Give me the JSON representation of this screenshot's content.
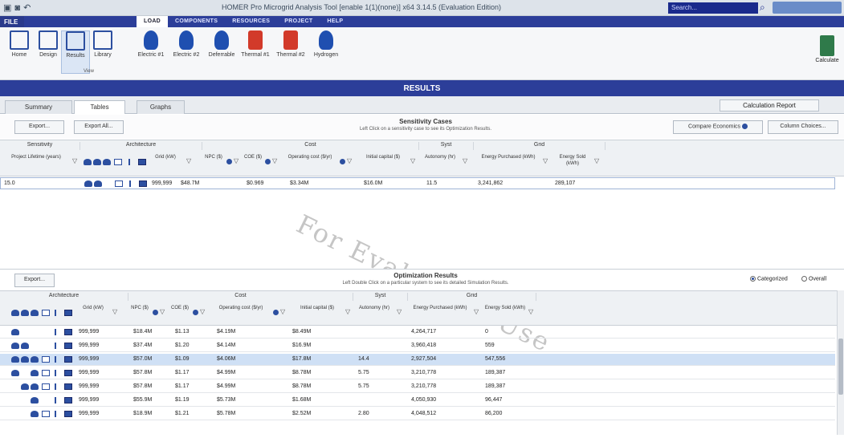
{
  "titlebar": {
    "title": "HOMER Pro Microgrid Analysis Tool [enable 1(1)(none)]  x64 3.14.5 (Evaluation Edition)",
    "search_placeholder": "Search..."
  },
  "menu": {
    "file": "FILE",
    "tabs": [
      "LOAD",
      "COMPONENTS",
      "RESOURCES",
      "PROJECT",
      "HELP"
    ],
    "active_tab": "LOAD"
  },
  "ribbon": {
    "buttons": [
      "Home",
      "Design",
      "Results",
      "Library",
      "Electric #1",
      "Electric #2",
      "Deferrable",
      "Thermal #1",
      "Thermal #2",
      "Hydrogen"
    ],
    "view_label": "View",
    "calculate": "Calculate"
  },
  "banner": "RESULTS",
  "view_tabs": {
    "tabs": [
      "Summary",
      "Tables",
      "Graphs"
    ],
    "active": "Tables",
    "calc_report": "Calculation Report"
  },
  "sensitivity": {
    "export": "Export...",
    "export_all": "Export All...",
    "title": "Sensitivity Cases",
    "subtitle": "Left Click on a sensitivity case to see its Optimization Results.",
    "compare_economics": "Compare Economics",
    "column_choices": "Column Choices...",
    "groups": [
      "Sensitivity",
      "Architecture",
      "Cost",
      "Syst",
      "Grid"
    ],
    "columns": [
      "Project Lifetime (years)",
      "Grid (kW)",
      "NPC ($)",
      "COE ($)",
      "Operating cost ($/yr)",
      "Initial capital ($)",
      "Autonomy (hr)",
      "Energy Purchased (kWh)",
      "Energy Sold (kWh)"
    ],
    "rows": [
      {
        "lifetime": "15.0",
        "grid": "999,999",
        "npc": "$48.7M",
        "coe": "$0.969",
        "opcost": "$3.34M",
        "capital": "$16.0M",
        "autonomy": "11.5",
        "purchased": "3,241,862",
        "sold": "289,107"
      }
    ]
  },
  "optimization": {
    "export": "Export...",
    "title": "Optimization Results",
    "subtitle": "Left Double Click on a particular system to see its detailed Simulation Results.",
    "categorized": "Categorized",
    "overall": "Overall",
    "groups": [
      "Architecture",
      "Cost",
      "Syst",
      "Grid"
    ],
    "columns": [
      "Grid (kW)",
      "NPC ($)",
      "COE ($)",
      "Operating cost ($/yr)",
      "Initial capital ($)",
      "Autonomy (hr)",
      "Energy Purchased (kWh)",
      "Energy Sold (kWh)"
    ],
    "rows": [
      {
        "arch": [
          1,
          0,
          0,
          0
        ],
        "grid": "999,999",
        "npc": "$18.4M",
        "coe": "$1.13",
        "opcost": "$4.19M",
        "capital": "$8.49M",
        "autonomy": "",
        "purchased": "4,264,717",
        "sold": "0"
      },
      {
        "arch": [
          1,
          1,
          0,
          0
        ],
        "grid": "999,999",
        "npc": "$37.4M",
        "coe": "$1.20",
        "opcost": "$4.14M",
        "capital": "$16.9M",
        "autonomy": "",
        "purchased": "3,960,418",
        "sold": "559"
      },
      {
        "arch": [
          1,
          1,
          1,
          1
        ],
        "grid": "999,999",
        "npc": "$57.0M",
        "coe": "$1.09",
        "opcost": "$4.06M",
        "capital": "$17.8M",
        "autonomy": "14.4",
        "purchased": "2,927,504",
        "sold": "547,556"
      },
      {
        "arch": [
          1,
          0,
          1,
          1
        ],
        "grid": "999,999",
        "npc": "$57.8M",
        "coe": "$1.17",
        "opcost": "$4.99M",
        "capital": "$8.78M",
        "autonomy": "5.75",
        "purchased": "3,210,778",
        "sold": "189,387"
      },
      {
        "arch": [
          0,
          1,
          1,
          1
        ],
        "grid": "999,999",
        "npc": "$57.8M",
        "coe": "$1.17",
        "opcost": "$4.99M",
        "capital": "$8.78M",
        "autonomy": "5.75",
        "purchased": "3,210,778",
        "sold": "189,387"
      },
      {
        "arch": [
          0,
          0,
          1,
          0
        ],
        "grid": "999,999",
        "npc": "$55.9M",
        "coe": "$1.19",
        "opcost": "$5.73M",
        "capital": "$1.68M",
        "autonomy": "",
        "purchased": "4,050,930",
        "sold": "96,447"
      },
      {
        "arch": [
          0,
          0,
          1,
          1
        ],
        "grid": "999,999",
        "npc": "$18.9M",
        "coe": "$1.21",
        "opcost": "$5.78M",
        "capital": "$2.52M",
        "autonomy": "2.80",
        "purchased": "4,048,512",
        "sold": "86,200"
      }
    ],
    "selected_row": 2
  },
  "watermark": "For Evaluation Use"
}
